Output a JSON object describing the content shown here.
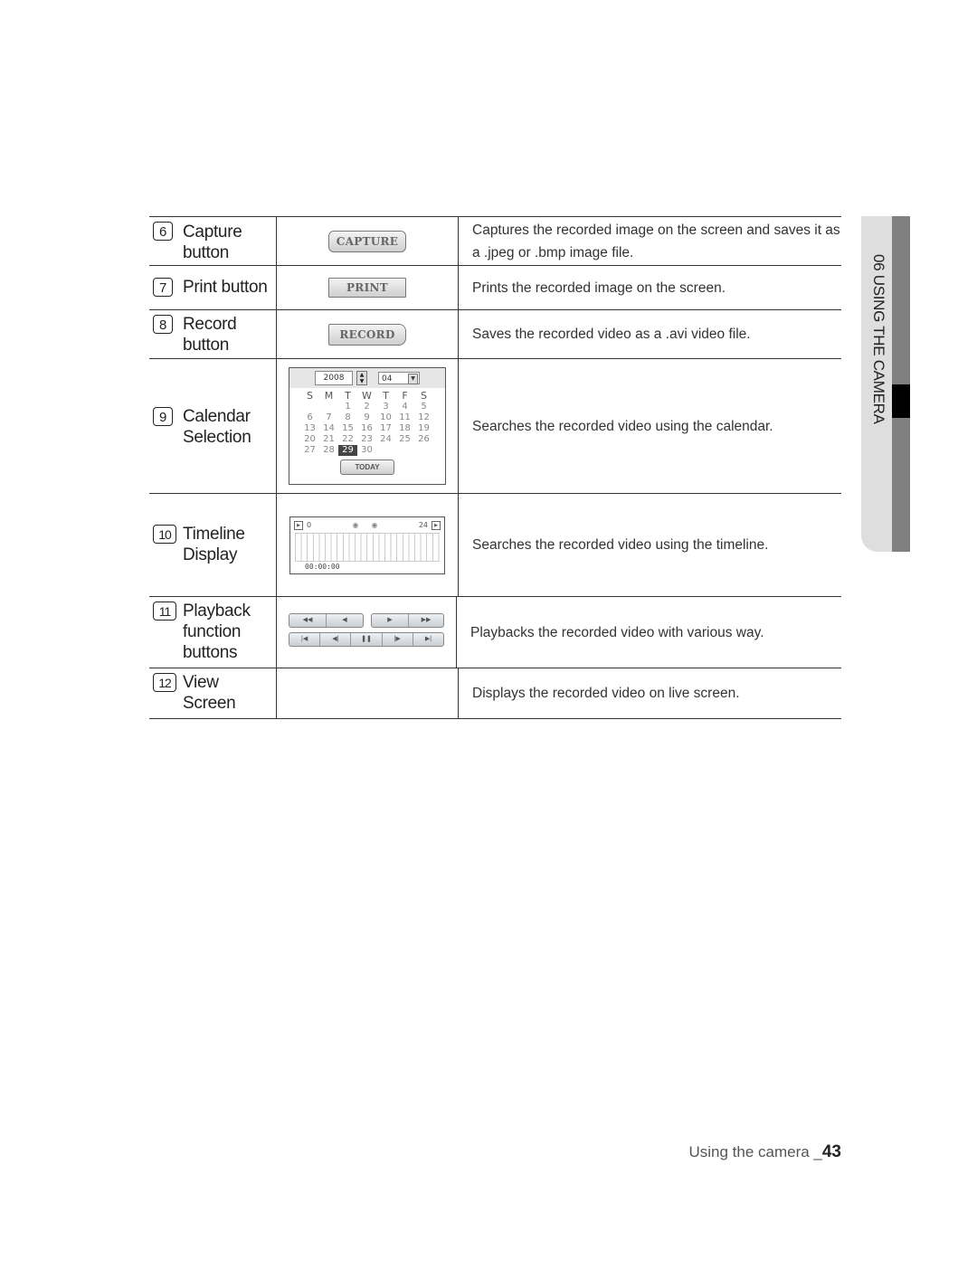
{
  "sidebar_tab": {
    "label": "06  USING THE CAMERA"
  },
  "rows": [
    {
      "num": "6",
      "label": "Capture button",
      "button": "CAPTURE",
      "description": "Captures the recorded image on the screen and saves it as a .jpeg or .bmp image file."
    },
    {
      "num": "7",
      "label": "Print button",
      "button": "PRINT",
      "description": "Prints the recorded image on the screen."
    },
    {
      "num": "8",
      "label": "Record button",
      "button": "RECORD",
      "description": "Saves the recorded video as a .avi video file."
    },
    {
      "num": "9",
      "label": "Calendar Selection",
      "description": "Searches the recorded video using the calendar."
    },
    {
      "num": "10",
      "label": "Timeline Display",
      "description": "Searches the recorded video using the timeline."
    },
    {
      "num": "11",
      "label": "Playback function buttons",
      "description": "Playbacks the recorded video with various way."
    },
    {
      "num": "12",
      "label": "View Screen",
      "description": "Displays the recorded video on live screen."
    }
  ],
  "calendar": {
    "year": "2008",
    "month": "04",
    "weekdays": [
      "S",
      "M",
      "T",
      "W",
      "T",
      "F",
      "S"
    ],
    "days": [
      "",
      "",
      "1",
      "2",
      "3",
      "4",
      "5",
      "6",
      "7",
      "8",
      "9",
      "10",
      "11",
      "12",
      "13",
      "14",
      "15",
      "16",
      "17",
      "18",
      "19",
      "20",
      "21",
      "22",
      "23",
      "24",
      "25",
      "26",
      "27",
      "28",
      "29",
      "30"
    ],
    "selected_day": "29",
    "today_label": "TODAY"
  },
  "timeline": {
    "start": "0",
    "end": "24",
    "time": "00:00:00"
  },
  "playback": {
    "row1": [
      "rewind-icon",
      "reverse-play-icon",
      "play-icon",
      "fast-forward-icon"
    ],
    "row2": [
      "skip-start-icon",
      "step-back-icon",
      "pause-icon",
      "step-forward-icon",
      "skip-end-icon"
    ]
  },
  "footer": {
    "text": "Using the camera _",
    "page": "43"
  }
}
